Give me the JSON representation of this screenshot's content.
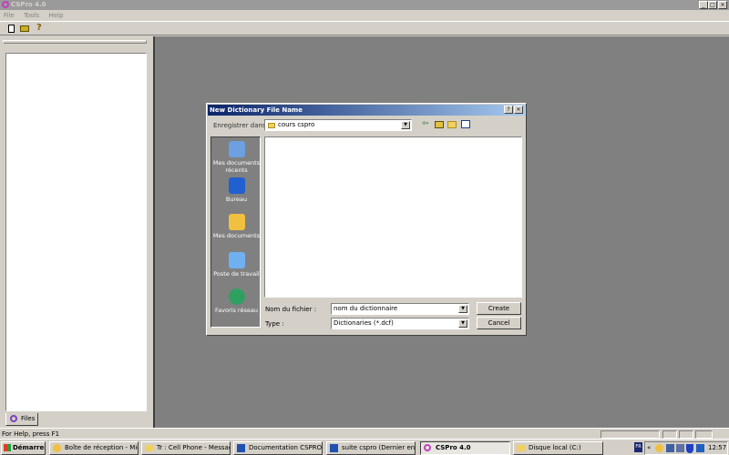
{
  "app": {
    "title": "CSPro 4.0",
    "menu": [
      "File",
      "Tools",
      "Help"
    ]
  },
  "toolbar": {
    "icons": [
      "new-file-icon",
      "open-folder-icon",
      "help-icon"
    ]
  },
  "left_panel": {
    "tab": "Files"
  },
  "status_bar": {
    "text": "For Help, press F1"
  },
  "dialog": {
    "title": "New Dictionary File Name",
    "look_in_label": "Enregistrer dans :",
    "look_in_value": "cours cspro",
    "places": [
      "Mes documents récents",
      "Bureau",
      "Mes documents",
      "Poste de travail",
      "Favoris réseau"
    ],
    "filename_label": "Nom du fichier :",
    "filename_value": "nom du dictionnaire",
    "type_label": "Type :",
    "type_value": "Dictionaries (*.dcf)",
    "create_label": "Create",
    "cancel_label": "Cancel",
    "help_btn": "?",
    "close_btn": "×"
  },
  "taskbar": {
    "start": "Démarrer",
    "items": [
      "Boîte de réception - Micr...",
      "Tr : Cell Phone - Messag...",
      "Documentation CSPRO v...",
      "suite cspro (Dernier enre...",
      "CSPro 4.0",
      "Disque local (C:)"
    ],
    "lang": "FR",
    "clock": "12:57"
  },
  "colors": {
    "mdi": "#808080",
    "title_active": "#0a246a",
    "face": "#d4d0c8"
  }
}
